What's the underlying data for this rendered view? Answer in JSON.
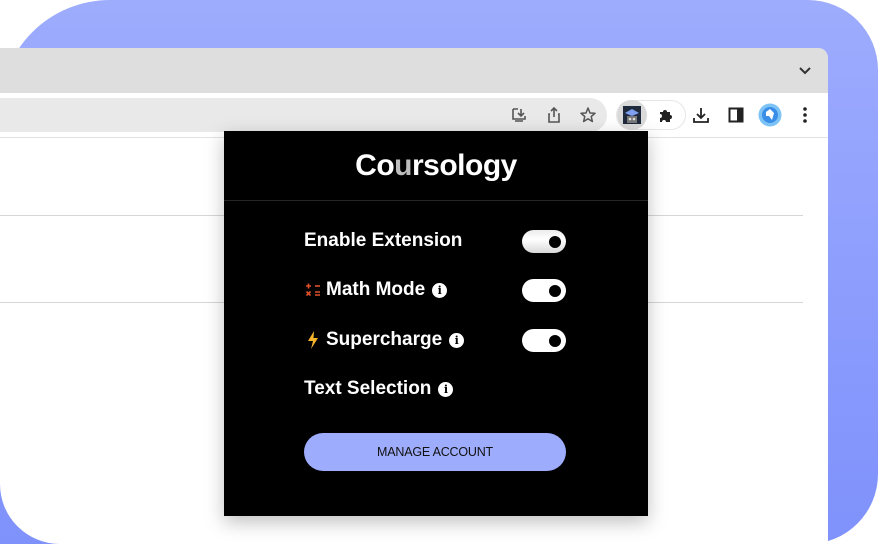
{
  "colors": {
    "backdrop": "#9eacfd",
    "accent": "#9eacfd",
    "popup_bg": "#000000",
    "math_icon": "#e0502a",
    "bolt_icon": "#f6b42a"
  },
  "browser": {
    "tabstrip": {
      "menu_icon": "chevron-down-icon"
    },
    "omnibox": {
      "icons": [
        "install-app-icon",
        "share-icon",
        "bookmark-star-icon"
      ]
    },
    "toolbar_icons": [
      "coursology-extension-icon",
      "extensions-puzzle-icon",
      "downloads-icon",
      "side-panel-icon",
      "profile-avatar",
      "more-menu-icon"
    ]
  },
  "popup": {
    "logo": {
      "pre": "Co",
      "accent": "u",
      "post": "rsology"
    },
    "settings": [
      {
        "label": "Enable Extension",
        "icon": null,
        "info": false,
        "toggle": true,
        "enabled": true
      },
      {
        "label": "Math Mode",
        "icon": "math-operators-icon",
        "info": true,
        "toggle": true,
        "enabled": true
      },
      {
        "label": "Supercharge",
        "icon": "lightning-bolt-icon",
        "info": true,
        "toggle": true,
        "enabled": true
      },
      {
        "label": "Text Selection",
        "icon": null,
        "info": true,
        "toggle": false
      }
    ],
    "info_glyph": "i",
    "manage_button": "MANAGE ACCOUNT"
  }
}
